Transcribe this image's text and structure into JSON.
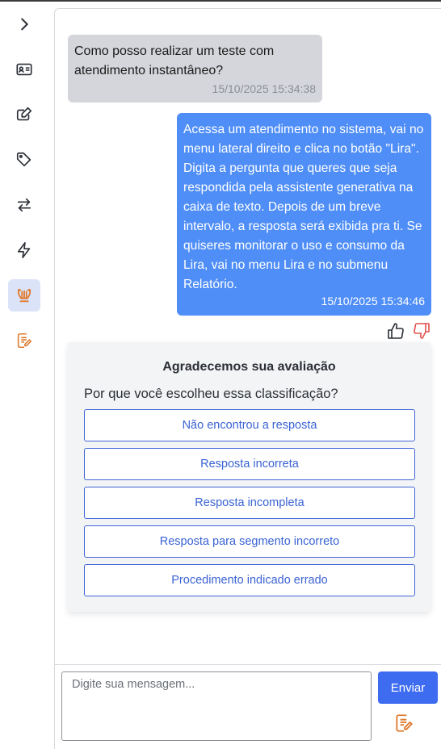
{
  "sidebar": {
    "items": [
      {
        "icon": "chevron-right-icon"
      },
      {
        "icon": "contact-card-icon"
      },
      {
        "icon": "edit-square-icon"
      },
      {
        "icon": "tag-icon"
      },
      {
        "icon": "transfer-arrows-icon"
      },
      {
        "icon": "lightning-icon"
      },
      {
        "icon": "lira-lyre-icon",
        "active": true
      },
      {
        "icon": "notes-pen-icon"
      }
    ]
  },
  "chat": {
    "messages": [
      {
        "side": "incoming",
        "text": "Como posso realizar um teste com atendimento instantâneo?",
        "time": "15/10/2025 15:34:38"
      },
      {
        "side": "outgoing",
        "text": "Acessa um atendimento no sistema, vai no menu lateral direito e clica no botão \"Lira\". Digita a pergunta que queres que seja respondida pela assistente generativa na caixa de texto. Depois de um breve intervalo, a resposta será exibida pra ti. Se quiseres monitorar o uso e consumo da Lira, vai no menu Lira e no submenu Relatório.",
        "time": "15/10/2025 15:34:46"
      }
    ],
    "rating": {
      "thumbs_up_icon": "thumbs-up-icon",
      "thumbs_down_icon": "thumbs-down-icon",
      "selected": "down",
      "down_color": "#e0524f"
    }
  },
  "feedback": {
    "title": "Agradecemos sua avaliação",
    "question": "Por que você escolheu essa classificação?",
    "options": [
      "Não encontrou a resposta",
      "Resposta incorreta",
      "Resposta incompleta",
      "Resposta para segmento incorreto",
      "Procedimento indicado errado"
    ]
  },
  "composer": {
    "placeholder": "Digite sua mensagem...",
    "send_label": "Enviar"
  },
  "colors": {
    "accent": "#3d6cf0",
    "outgoing_bubble": "#4f8ef7",
    "incoming_bubble": "#d4d6db",
    "active_rail": "#dbe3f8",
    "orange_icon": "#e07a2e"
  }
}
